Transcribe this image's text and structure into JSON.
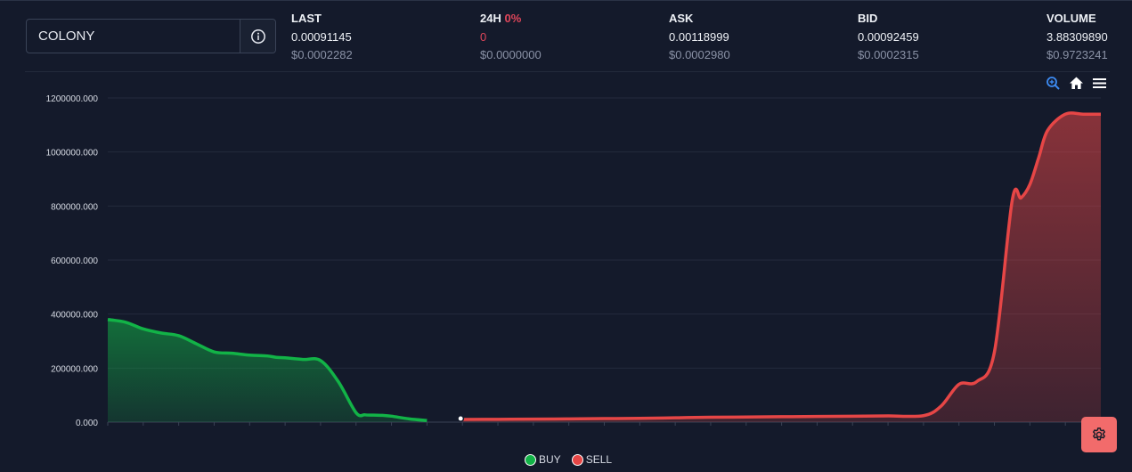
{
  "search": {
    "value": "COLONY",
    "placeholder": ""
  },
  "stats": [
    {
      "label": "LAST",
      "value": "0.00091145",
      "usd": "$0.0002282"
    },
    {
      "label": "24H",
      "pct": "0%",
      "value": "0",
      "usd": "$0.0000000"
    },
    {
      "label": "ASK",
      "value": "0.00118999",
      "usd": "$0.0002980"
    },
    {
      "label": "BID",
      "value": "0.00092459",
      "usd": "$0.0002315"
    },
    {
      "label": "VOLUME",
      "value": "3.88309890",
      "usd": "$0.9723241"
    }
  ],
  "colors": {
    "buy": "#12b347",
    "sell": "#e64646",
    "background": "#141a2b",
    "accent": "#3d8bf2",
    "gear_button": "#f26b6b"
  },
  "icons": {
    "info": "info-icon",
    "zoom": "zoom-in-icon",
    "home": "home-icon",
    "menu": "menu-icon",
    "settings": "gear-icon"
  },
  "legend": {
    "buy": "BUY",
    "sell": "SELL"
  },
  "chart_data": {
    "type": "area",
    "title": "",
    "xlabel": "",
    "ylabel": "",
    "ylim": [
      0,
      1200000
    ],
    "yticks": [
      "0.000",
      "200000.000",
      "400000.000",
      "600000.000",
      "800000.000",
      "1000000.000",
      "1200000.000"
    ],
    "grid": true,
    "legend_position": "bottom-center",
    "series": [
      {
        "name": "BUY",
        "color": "#12b347",
        "x": [
          0,
          2,
          4,
          6,
          8,
          10,
          12,
          14,
          16,
          18,
          19,
          20,
          22,
          24,
          26,
          28,
          29,
          30,
          31,
          32,
          34,
          36
        ],
        "y": [
          380000,
          370000,
          345000,
          330000,
          320000,
          290000,
          260000,
          255000,
          248000,
          245000,
          240000,
          238000,
          232000,
          228000,
          150000,
          35000,
          27000,
          26000,
          25000,
          22000,
          12000,
          6000
        ]
      },
      {
        "name": "SELL",
        "color": "#e64646",
        "x": [
          40,
          44,
          48,
          52,
          56,
          60,
          64,
          68,
          72,
          76,
          80,
          84,
          88,
          92,
          94,
          96,
          98,
          100,
          102,
          103,
          104,
          105,
          106,
          108,
          110,
          112
        ],
        "y": [
          10000,
          10500,
          11000,
          12000,
          13000,
          14000,
          16000,
          18000,
          19000,
          20000,
          21000,
          22000,
          23000,
          24000,
          60000,
          140000,
          150000,
          260000,
          820000,
          830000,
          880000,
          980000,
          1080000,
          1140000,
          1140000,
          1140000
        ]
      }
    ]
  }
}
